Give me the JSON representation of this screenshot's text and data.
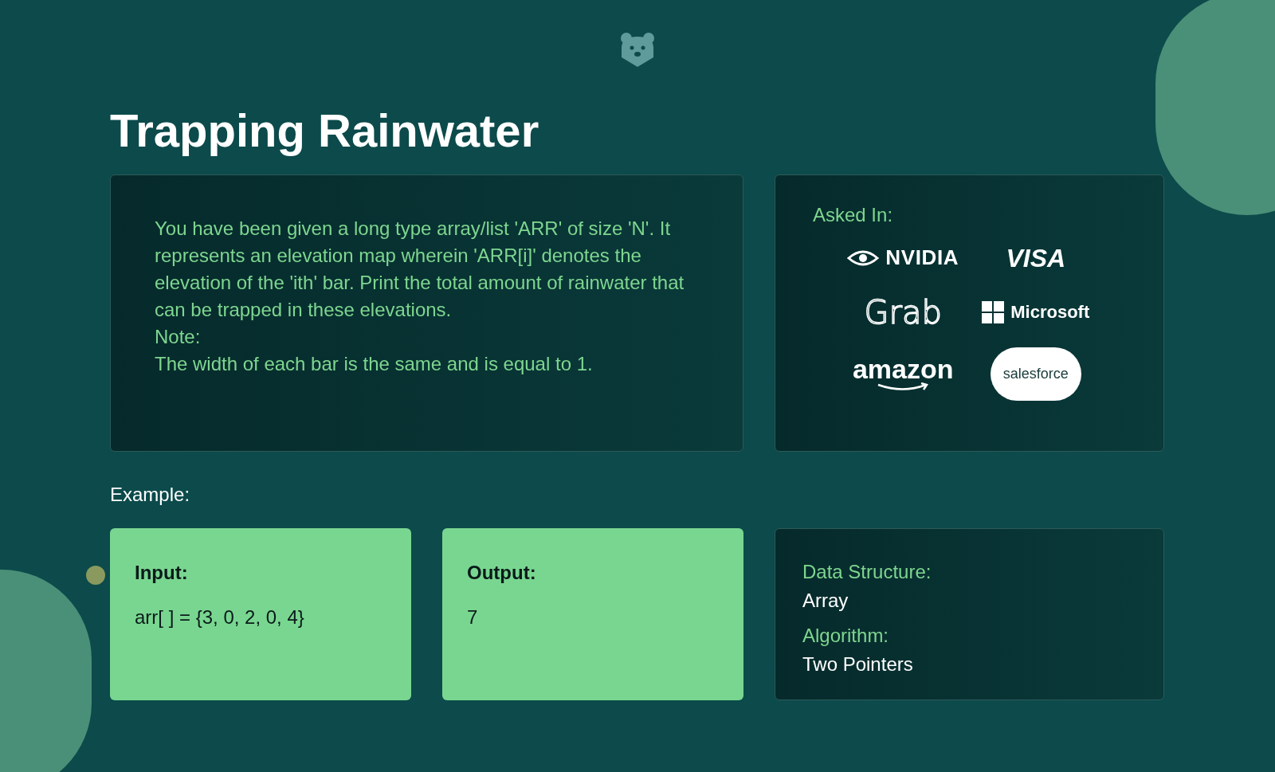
{
  "title": "Trapping Rainwater",
  "description": {
    "lines": [
      "You have been given a long type array/list 'ARR' of size 'N'. It represents an elevation map wherein 'ARR[i]' denotes the elevation of the 'ith' bar. Print the total amount of rainwater that can be trapped in these elevations.",
      "Note:",
      "The width of each bar is the same and is equal to 1."
    ]
  },
  "asked_in": {
    "label": "Asked In:",
    "companies": [
      {
        "name": "NVIDIA",
        "kind": "nvidia"
      },
      {
        "name": "VISA",
        "kind": "visa"
      },
      {
        "name": "Grab",
        "kind": "grab"
      },
      {
        "name": "Microsoft",
        "kind": "microsoft"
      },
      {
        "name": "amazon",
        "kind": "amazon"
      },
      {
        "name": "salesforce",
        "kind": "salesforce"
      }
    ]
  },
  "example_label": "Example:",
  "example": [
    {
      "label": "Input:",
      "value": "arr[ ] = {3, 0, 2, 0, 4}"
    },
    {
      "label": "Output:",
      "value": "7"
    }
  ],
  "meta": [
    {
      "label": "Data Structure:",
      "value": "Array"
    },
    {
      "label": "Algorithm:",
      "value": "Two Pointers"
    }
  ]
}
